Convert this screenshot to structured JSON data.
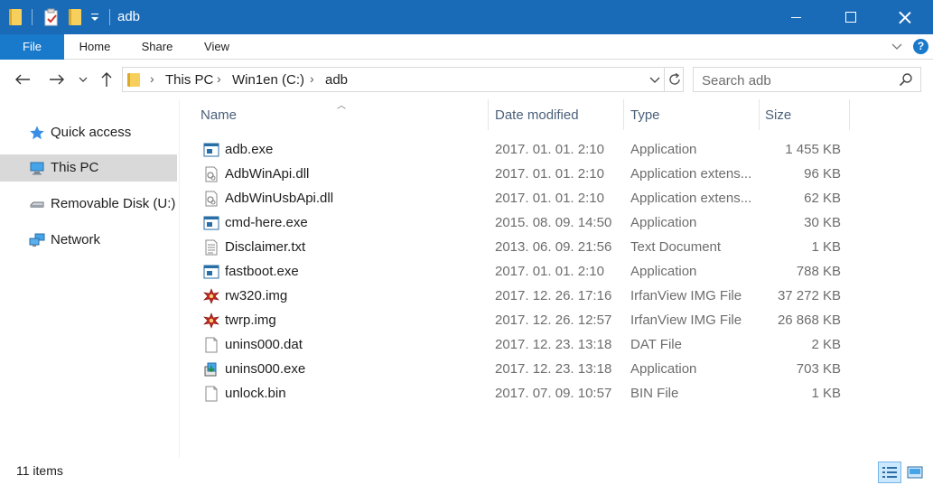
{
  "window": {
    "title": "adb",
    "controls": [
      "minimize",
      "maximize",
      "close"
    ]
  },
  "ribbon": {
    "tabs": [
      {
        "label": "File",
        "active": true
      },
      {
        "label": "Home"
      },
      {
        "label": "Share"
      },
      {
        "label": "View"
      }
    ],
    "help_label": "?"
  },
  "address": {
    "breadcrumbs": [
      "This PC",
      "Win1en (C:)",
      "adb"
    ],
    "search_placeholder": "Search adb"
  },
  "navigation_pane": {
    "items": [
      {
        "label": "Quick access",
        "icon": "star-icon"
      },
      {
        "label": "This PC",
        "icon": "computer-icon",
        "selected": true
      },
      {
        "label": "Removable Disk (U:)",
        "icon": "removable-disk-icon"
      },
      {
        "label": "Network",
        "icon": "network-icon"
      }
    ]
  },
  "file_list": {
    "columns": [
      "Name",
      "Date modified",
      "Type",
      "Size"
    ],
    "sorted_by": "Name",
    "rows": [
      {
        "name": "adb.exe",
        "date": "2017. 01. 01. 2:10",
        "type": "Application",
        "size": "1 455 KB",
        "icon": "exe-icon"
      },
      {
        "name": "AdbWinApi.dll",
        "date": "2017. 01. 01. 2:10",
        "type": "Application extens...",
        "size": "96 KB",
        "icon": "dll-icon"
      },
      {
        "name": "AdbWinUsbApi.dll",
        "date": "2017. 01. 01. 2:10",
        "type": "Application extens...",
        "size": "62 KB",
        "icon": "dll-icon"
      },
      {
        "name": "cmd-here.exe",
        "date": "2015. 08. 09. 14:50",
        "type": "Application",
        "size": "30 KB",
        "icon": "exe-icon"
      },
      {
        "name": "Disclaimer.txt",
        "date": "2013. 06. 09. 21:56",
        "type": "Text Document",
        "size": "1 KB",
        "icon": "text-file-icon"
      },
      {
        "name": "fastboot.exe",
        "date": "2017. 01. 01. 2:10",
        "type": "Application",
        "size": "788 KB",
        "icon": "exe-icon"
      },
      {
        "name": "rw320.img",
        "date": "2017. 12. 26. 17:16",
        "type": "IrfanView IMG File",
        "size": "37 272 KB",
        "icon": "irfanview-icon"
      },
      {
        "name": "twrp.img",
        "date": "2017. 12. 26. 12:57",
        "type": "IrfanView IMG File",
        "size": "26 868 KB",
        "icon": "irfanview-icon"
      },
      {
        "name": "unins000.dat",
        "date": "2017. 12. 23. 13:18",
        "type": "DAT File",
        "size": "2 KB",
        "icon": "blank-file-icon"
      },
      {
        "name": "unins000.exe",
        "date": "2017. 12. 23. 13:18",
        "type": "Application",
        "size": "703 KB",
        "icon": "installer-icon"
      },
      {
        "name": "unlock.bin",
        "date": "2017. 07. 09. 10:57",
        "type": "BIN File",
        "size": "1 KB",
        "icon": "blank-file-icon"
      }
    ]
  },
  "status": {
    "item_count": "11 items",
    "view_modes": [
      "details-view",
      "large-icons-view"
    ],
    "active_view": "details-view"
  },
  "colors": {
    "titlebar": "#1a6bb7",
    "file_tab": "#1979ca",
    "selected_nav": "#d9d9d9",
    "header_text": "#4c607a",
    "secondary_text": "#6d6d6d"
  }
}
